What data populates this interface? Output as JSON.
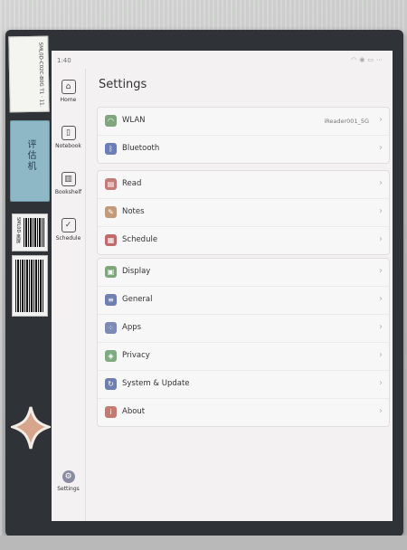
{
  "status": {
    "time": "1:40",
    "icons": [
      "wifi-icon",
      "location-icon",
      "battery-icon",
      "more-icon"
    ]
  },
  "sidebar": {
    "items": [
      {
        "label": "Home",
        "icon": "home-icon"
      },
      {
        "label": "Notebook",
        "icon": "notebook-icon"
      },
      {
        "label": "Bookshelf",
        "icon": "bookshelf-icon"
      },
      {
        "label": "Schedule",
        "icon": "calendar-icon"
      }
    ],
    "bottom": {
      "label": "Settings",
      "icon": "settings-icon"
    }
  },
  "page": {
    "title": "Settings"
  },
  "groups": {
    "connectivity": [
      {
        "label": "WLAN",
        "value": "iReader001_5G",
        "icon": "wlan-icon",
        "color": "#7fa67c"
      },
      {
        "label": "Bluetooth",
        "value": "",
        "icon": "bluetooth-icon",
        "color": "#6b7eb5"
      }
    ],
    "apps": [
      {
        "label": "Read",
        "icon": "read-icon",
        "color": "#c47c78"
      },
      {
        "label": "Notes",
        "icon": "notes-icon",
        "color": "#c49a78"
      },
      {
        "label": "Schedule",
        "icon": "schedule-icon",
        "color": "#c06a6a"
      }
    ],
    "system": [
      {
        "label": "Display",
        "icon": "display-icon",
        "color": "#7ea87a"
      },
      {
        "label": "General",
        "icon": "general-icon",
        "color": "#6f7fb0"
      },
      {
        "label": "Apps",
        "icon": "apps-icon",
        "color": "#7d89b6"
      },
      {
        "label": "Privacy",
        "icon": "privacy-icon",
        "color": "#7fab80"
      },
      {
        "label": "System & Update",
        "icon": "update-icon",
        "color": "#6d7fae"
      },
      {
        "label": "About",
        "icon": "about-icon",
        "color": "#c27b70"
      }
    ]
  },
  "stickers": {
    "top_label": "SML0D-C02C-B0G T1 · 11.",
    "blue_label": "评估机",
    "barcode_label": "SML0D-黑屏"
  }
}
